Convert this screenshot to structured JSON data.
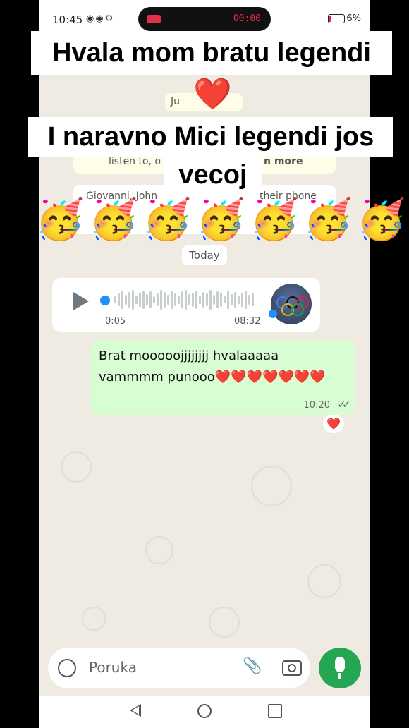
{
  "status_bar": {
    "time": "10:45",
    "left_icons": "◉◉⚙",
    "record_time": "00:00",
    "right_text": "6%"
  },
  "overlay": {
    "line1": "Hvala mom bratu legendi",
    "heart": "❤️",
    "line2": "I naravno Mici legendi jos",
    "line3": "vecoj",
    "emoji": "🥳"
  },
  "chat": {
    "date_partial": "Ju",
    "system_left": "listen to, o",
    "system_right": "n more",
    "system2_line1_left": "Giovanni, John",
    "system2_line1_right": "their phone",
    "today_label": "Today",
    "voice": {
      "duration": "0:05",
      "time": "08:32"
    },
    "message": {
      "text": "Brat mooooojjjjjjjj hvalaaaaa vammmm punooo❤️❤️❤️❤️❤️❤️❤️",
      "time": "10:20",
      "ticks": "✓✓",
      "reaction": "❤️"
    }
  },
  "input": {
    "placeholder": "Poruka",
    "clip_icon": "📎"
  },
  "colors": {
    "wallpaper": "#efeae2",
    "outgoing_bubble": "#d9fdd3",
    "mic_button": "#25a652"
  }
}
